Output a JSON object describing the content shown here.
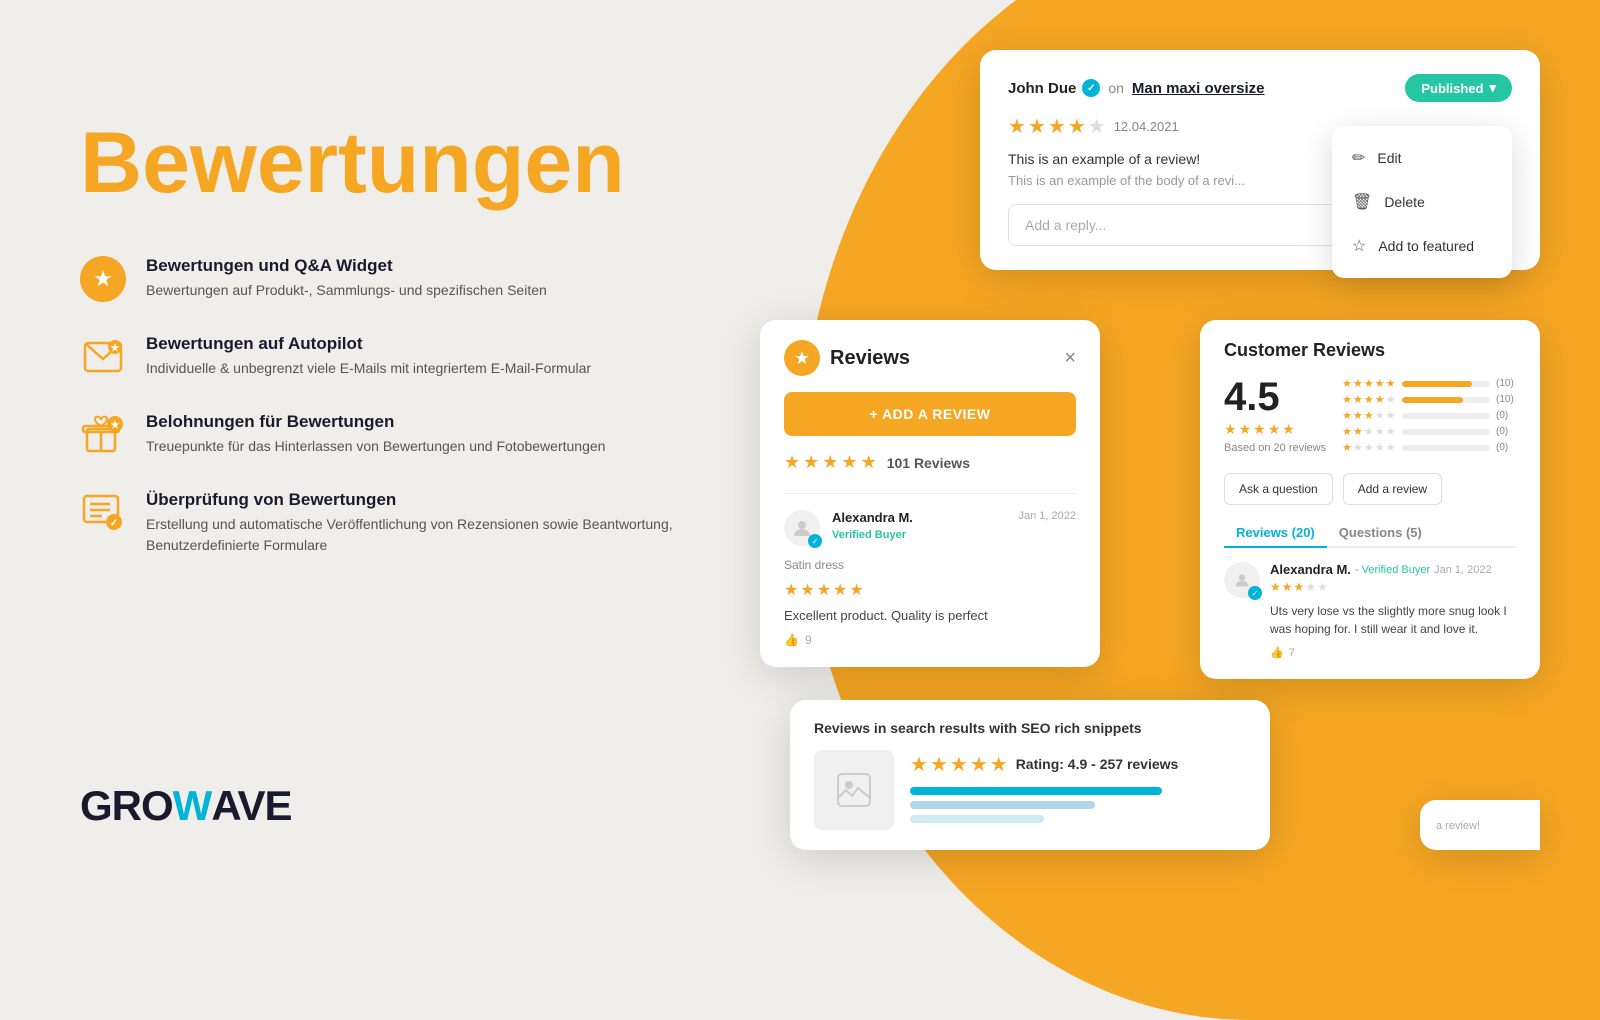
{
  "background": {
    "color": "#f0eeeb",
    "gold_shape_color": "#F5A623"
  },
  "hero": {
    "title": "Bewertungen"
  },
  "features": [
    {
      "icon": "★",
      "icon_type": "yellow_circle",
      "title": "Bewertungen und Q&A Widget",
      "description": "Bewertungen auf Produkt-, Sammlungs- und spezifischen Seiten"
    },
    {
      "icon": "✉",
      "icon_type": "outline",
      "title": "Bewertungen auf Autopilot",
      "description": "Individuelle & unbegrenzt viele E-Mails mit integriertem E-Mail-Formular"
    },
    {
      "icon": "🏛",
      "icon_type": "outline_star",
      "title": "Belohnungen für Bewertungen",
      "description": "Treuepunkte für das Hinterlassen von Bewertungen und Fotobewertungen"
    },
    {
      "icon": "📋",
      "icon_type": "outline",
      "title": "Überprüfung von Bewertungen",
      "description": "Erstellung und automatische Veröffentlichung von Rezensionen sowie Beantwortung, Benutzerdefinierte Formulare"
    }
  ],
  "logo": {
    "gro": "GRO",
    "w": "W",
    "ave": "AVE"
  },
  "review_admin_card": {
    "reviewer_name": "John Due",
    "on_text": "on",
    "product_link": "Man maxi oversize",
    "status": "Published",
    "date": "12.04.2021",
    "rating": 3.5,
    "review_title": "This is an example of a review!",
    "review_excerpt": "This is an example of the body of a revi...",
    "reply_placeholder": "Add a reply...",
    "dropdown": {
      "edit_label": "Edit",
      "delete_label": "Delete",
      "featured_label": "Add to featured"
    }
  },
  "reviews_widget": {
    "title": "Reviews",
    "add_review_btn": "+ ADD A REVIEW",
    "close_icon": "×",
    "rating_count": "101 Reviews",
    "reviewer": {
      "name": "Alexandra M.",
      "verified": "Verified Buyer",
      "date": "Jan 1, 2022",
      "product": "Satin dress",
      "rating_stars": 5,
      "review_text": "Excellent product. Quality is perfect",
      "helpful_count": 9
    }
  },
  "customer_reviews": {
    "title": "Customer Reviews",
    "avg_score": "4.5",
    "based_on": "Based on 20 reviews",
    "bars": [
      {
        "stars": 5,
        "fill_pct": 80,
        "count": "(10)"
      },
      {
        "stars": 4,
        "fill_pct": 70,
        "count": "(10)"
      },
      {
        "stars": 3,
        "fill_pct": 0,
        "count": "(0)"
      },
      {
        "stars": 2,
        "fill_pct": 0,
        "count": "(0)"
      },
      {
        "stars": 1,
        "fill_pct": 0,
        "count": "(0)"
      }
    ],
    "ask_question_btn": "Ask a question",
    "add_review_btn": "Add a review",
    "tabs": [
      {
        "label": "Reviews (20)",
        "active": true
      },
      {
        "label": "Questions (5)",
        "active": false
      }
    ],
    "reviewer": {
      "name": "Alexandra M.",
      "verified": "- Verified Buyer",
      "date": "Jan 1, 2022",
      "rating_stars": 3,
      "review_text": "Uts very lose vs the slightly more snug look I was hoping for. I still wear it and love it.",
      "helpful_count": 7
    }
  },
  "seo_card": {
    "title": "Reviews in search results with SEO rich snippets",
    "rating_text": "Rating: 4.9 - 257 reviews"
  },
  "peek_card": {
    "text": "a review!"
  }
}
